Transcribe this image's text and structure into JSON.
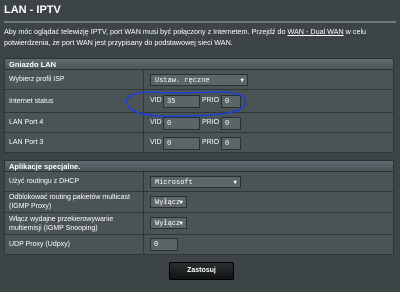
{
  "page": {
    "title": "LAN - IPTV",
    "desc_part1": "Aby móc oglądać telewizję IPTV, port WAN musi być połączony z Internetem. Przejdź do ",
    "desc_link": "WAN - Dual WAN",
    "desc_part2": " w celu potwierdzenia, że port WAN jest przypisany do podstawowej sieci WAN."
  },
  "lan_section": {
    "heading": "Gniazdo LAN",
    "isp_label": "Wybierz profil ISP",
    "isp_value": "Ustaw. ręczne",
    "internet_label": "Internet status",
    "internet_vid": "35",
    "internet_prio": "0",
    "lan4_label": "LAN Port 4",
    "lan4_vid": "0",
    "lan4_prio": "0",
    "lan3_label": "LAN Port 3",
    "lan3_vid": "0",
    "lan3_prio": "0",
    "vid_label": "VID",
    "prio_label": "PRIO"
  },
  "special_section": {
    "heading": "Aplikacje specjalne.",
    "dhcp_label": "Użyć routingu z DHCP",
    "dhcp_value": "Microsoft",
    "multicast_label": "Odblokować routing pakietów multicast (IGMP Proxy)",
    "multicast_value": "Wyłącz",
    "snooping_label": "Włącz wydajne przekierowywanie multiemisji (IGMP Snooping)",
    "snooping_value": "Wyłącz",
    "udp_label": "UDP Proxy (Udpxy)",
    "udp_value": "0"
  },
  "actions": {
    "apply_label": "Zastosuj"
  },
  "colors": {
    "background": "#3d4446",
    "annotation": "#1f3fd8"
  }
}
